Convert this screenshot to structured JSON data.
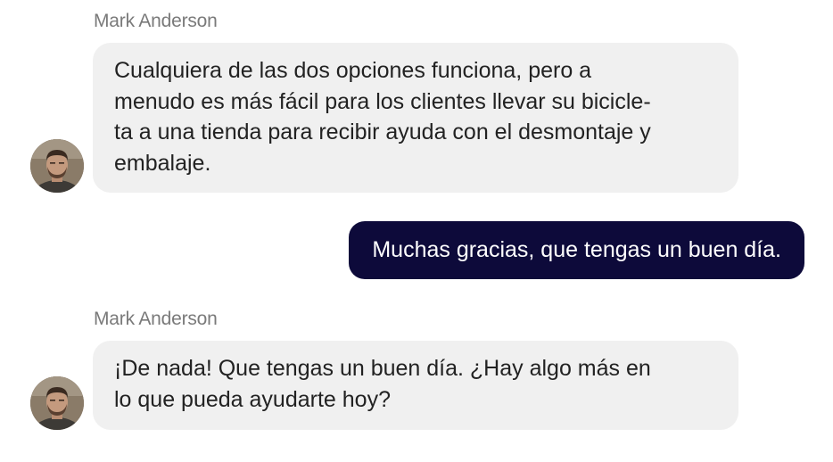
{
  "conversation": {
    "messages": [
      {
        "sender": "Mark Anderson",
        "direction": "incoming",
        "lines": [
          "Cualquiera de las dos opciones funciona, pero a",
          "menudo es más fácil para los clientes llevar su bicicle-",
          "ta a una tienda para recibir ayuda con el desmontaje y",
          "embalaje."
        ]
      },
      {
        "direction": "outgoing",
        "text": "Muchas gracias, que tengas un buen día."
      },
      {
        "sender": "Mark Anderson",
        "direction": "incoming",
        "lines": [
          "¡De nada! Que tengas un buen día. ¿Hay algo más en",
          "lo que pueda ayudarte hoy?"
        ]
      }
    ]
  },
  "colors": {
    "incoming_bubble": "#f0f0f0",
    "outgoing_bubble": "#0d0a3a",
    "sender_name": "#7a7a7a"
  }
}
